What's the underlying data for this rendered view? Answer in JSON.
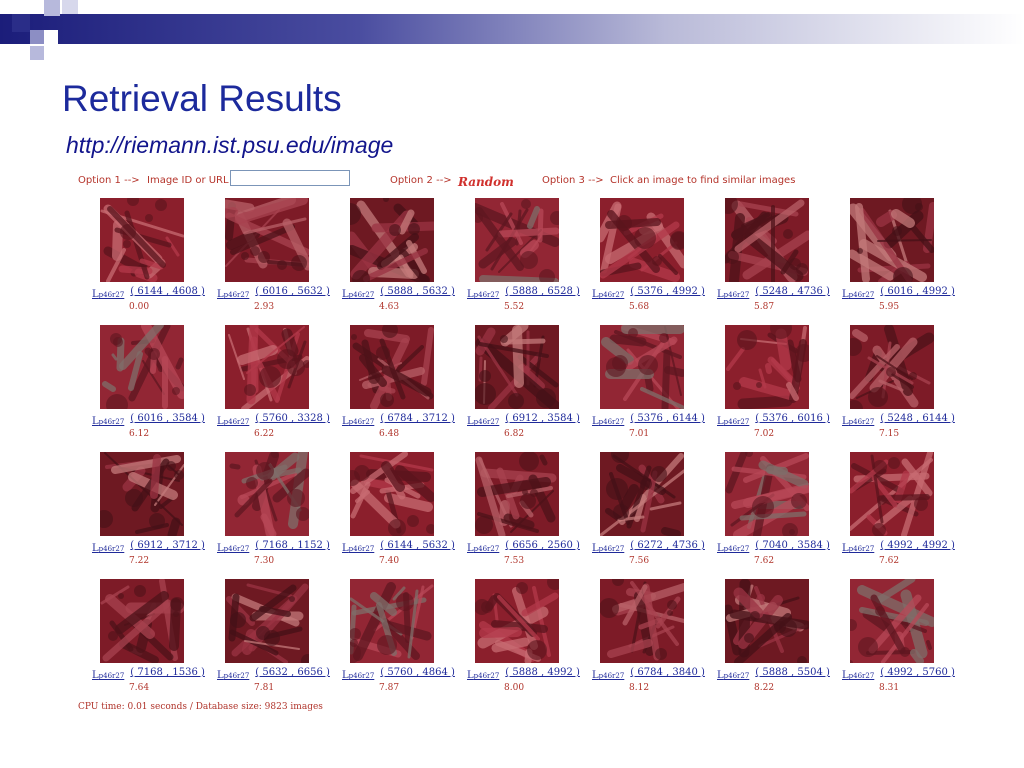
{
  "slide": {
    "title": "Retrieval Results",
    "url": "http://riemann.ist.psu.edu/image"
  },
  "options": {
    "option1_label": "Option 1 -->",
    "option1_field_label": "Image ID or URL",
    "option1_value": "",
    "option2_label": "Option 2 -->",
    "random_label": "Random",
    "option3_label": "Option 3 -->",
    "option3_text": "Click an image to find similar images"
  },
  "colors": {
    "accent_text": "#b5342b",
    "link": "#1f2a9a",
    "title": "#1c2a9c"
  },
  "results": [
    {
      "link": "Lp46r27",
      "coord": "( 6144 , 4608 )",
      "dist": "0.00"
    },
    {
      "link": "Lp46r27",
      "coord": "( 6016 , 5632 )",
      "dist": "2.93"
    },
    {
      "link": "Lp46r27",
      "coord": "( 5888 , 5632 )",
      "dist": "4.63"
    },
    {
      "link": "Lp46r27",
      "coord": "( 5888 , 6528 )",
      "dist": "5.52"
    },
    {
      "link": "Lp46r27",
      "coord": "( 5376 , 4992 )",
      "dist": "5.68"
    },
    {
      "link": "Lp46r27",
      "coord": "( 5248 , 4736 )",
      "dist": "5.87"
    },
    {
      "link": "Lp46r27",
      "coord": "( 6016 , 4992 )",
      "dist": "5.95"
    },
    {
      "link": "Lp46r27",
      "coord": "( 6016 , 3584 )",
      "dist": "6.12"
    },
    {
      "link": "Lp46r27",
      "coord": "( 5760 , 3328 )",
      "dist": "6.22"
    },
    {
      "link": "Lp46r27",
      "coord": "( 6784 , 3712 )",
      "dist": "6.48"
    },
    {
      "link": "Lp46r27",
      "coord": "( 6912 , 3584 )",
      "dist": "6.82"
    },
    {
      "link": "Lp46r27",
      "coord": "( 5376 , 6144 )",
      "dist": "7.01"
    },
    {
      "link": "Lp46r27",
      "coord": "( 5376 , 6016 )",
      "dist": "7.02"
    },
    {
      "link": "Lp46r27",
      "coord": "( 5248 , 6144 )",
      "dist": "7.15"
    },
    {
      "link": "Lp46r27",
      "coord": "( 6912 , 3712 )",
      "dist": "7.22"
    },
    {
      "link": "Lp46r27",
      "coord": "( 7168 , 1152 )",
      "dist": "7.30"
    },
    {
      "link": "Lp46r27",
      "coord": "( 6144 , 5632 )",
      "dist": "7.40"
    },
    {
      "link": "Lp46r27",
      "coord": "( 6656 , 2560 )",
      "dist": "7.53"
    },
    {
      "link": "Lp46r27",
      "coord": "( 6272 , 4736 )",
      "dist": "7.56"
    },
    {
      "link": "Lp46r27",
      "coord": "( 7040 , 3584 )",
      "dist": "7.62"
    },
    {
      "link": "Lp46r27",
      "coord": "( 4992 , 4992 )",
      "dist": "7.62"
    },
    {
      "link": "Lp46r27",
      "coord": "( 7168 , 1536 )",
      "dist": "7.64"
    },
    {
      "link": "Lp46r27",
      "coord": "( 5632 , 6656 )",
      "dist": "7.81"
    },
    {
      "link": "Lp46r27",
      "coord": "( 5760 , 4864 )",
      "dist": "7.87"
    },
    {
      "link": "Lp46r27",
      "coord": "( 5888 , 4992 )",
      "dist": "8.00"
    },
    {
      "link": "Lp46r27",
      "coord": "( 6784 , 3840 )",
      "dist": "8.12"
    },
    {
      "link": "Lp46r27",
      "coord": "( 5888 , 5504 )",
      "dist": "8.22"
    },
    {
      "link": "Lp46r27",
      "coord": "( 4992 , 5760 )",
      "dist": "8.31"
    }
  ],
  "footer": {
    "cpu_text": "CPU time: 0.01 seconds / Database size: 9823 images"
  }
}
